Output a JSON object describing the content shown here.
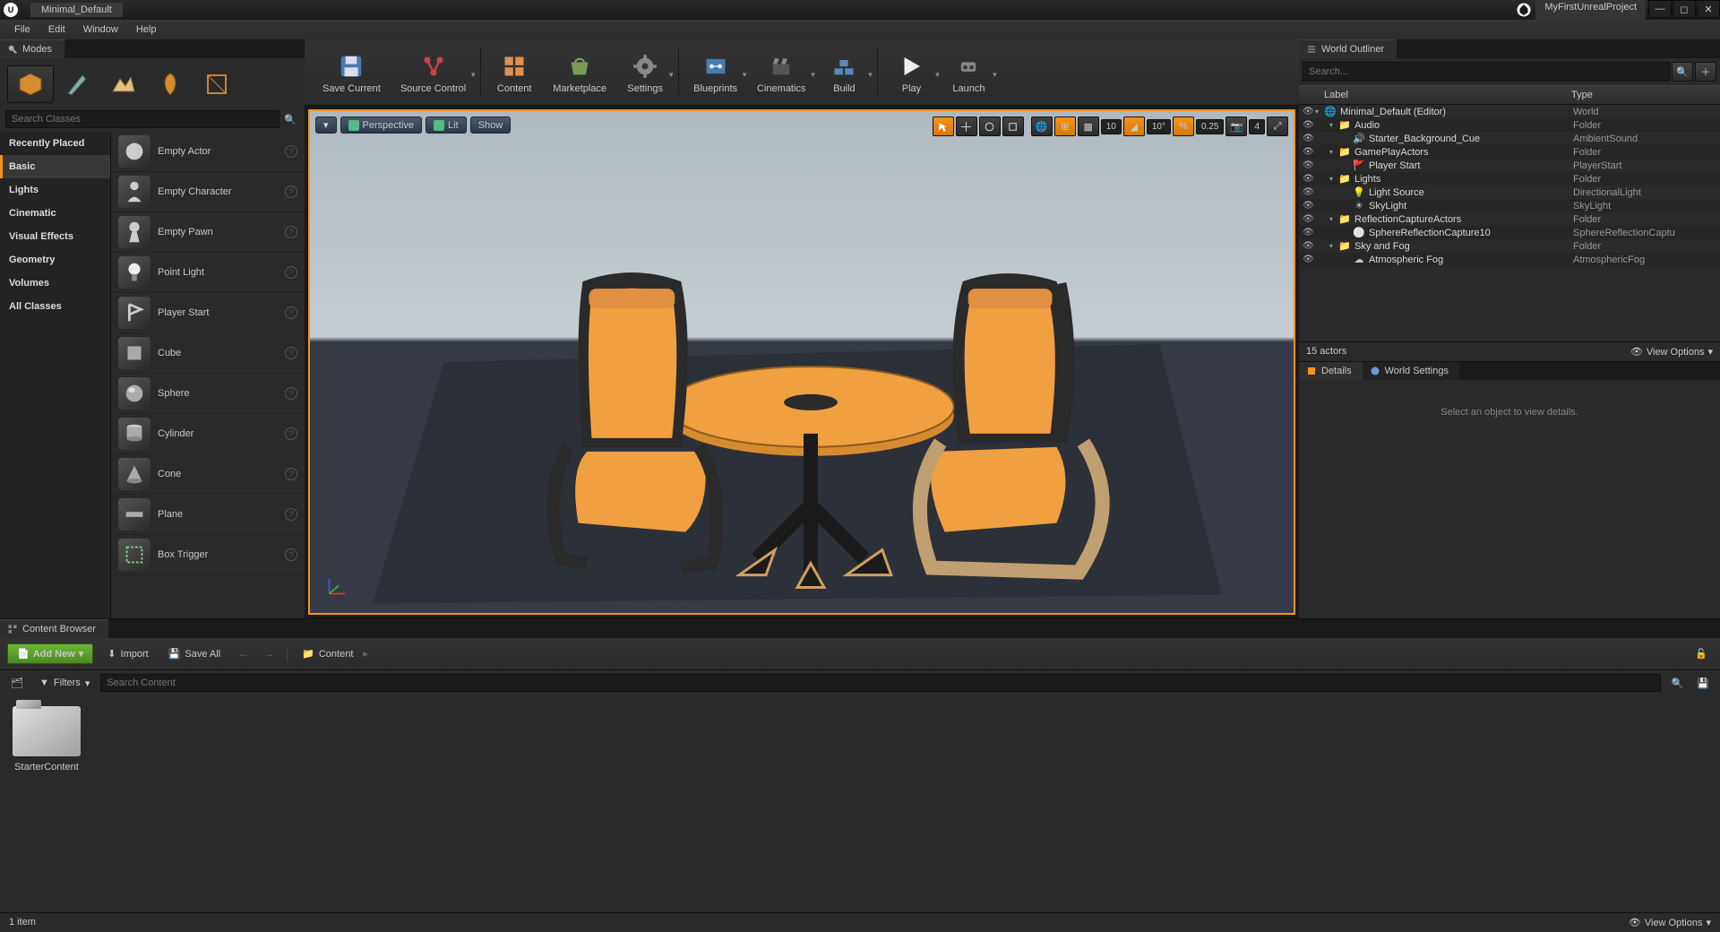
{
  "titlebar": {
    "doc_name": "Minimal_Default",
    "project_name": "MyFirstUnrealProject"
  },
  "menubar": [
    "File",
    "Edit",
    "Window",
    "Help"
  ],
  "modes_panel_title": "Modes",
  "search_classes_placeholder": "Search Classes",
  "place_categories": [
    {
      "label": "Recently Placed",
      "active": false
    },
    {
      "label": "Basic",
      "active": true
    },
    {
      "label": "Lights",
      "active": false
    },
    {
      "label": "Cinematic",
      "active": false
    },
    {
      "label": "Visual Effects",
      "active": false
    },
    {
      "label": "Geometry",
      "active": false
    },
    {
      "label": "Volumes",
      "active": false
    },
    {
      "label": "All Classes",
      "active": false
    }
  ],
  "place_items": [
    {
      "label": "Empty Actor",
      "icon": "actor"
    },
    {
      "label": "Empty Character",
      "icon": "character"
    },
    {
      "label": "Empty Pawn",
      "icon": "pawn"
    },
    {
      "label": "Point Light",
      "icon": "light"
    },
    {
      "label": "Player Start",
      "icon": "playerstart"
    },
    {
      "label": "Cube",
      "icon": "cube"
    },
    {
      "label": "Sphere",
      "icon": "sphere"
    },
    {
      "label": "Cylinder",
      "icon": "cylinder"
    },
    {
      "label": "Cone",
      "icon": "cone"
    },
    {
      "label": "Plane",
      "icon": "plane"
    },
    {
      "label": "Box Trigger",
      "icon": "boxtrigger"
    }
  ],
  "toolbar": {
    "save": "Save Current",
    "source": "Source Control",
    "content": "Content",
    "marketplace": "Marketplace",
    "settings": "Settings",
    "blueprints": "Blueprints",
    "cinematics": "Cinematics",
    "build": "Build",
    "play": "Play",
    "launch": "Launch"
  },
  "viewport": {
    "perspective": "Perspective",
    "lit": "Lit",
    "show": "Show",
    "grid_size": "10",
    "angle_snap": "10°",
    "scale_snap": "0.25",
    "cam_speed": "4"
  },
  "outliner": {
    "title": "World Outliner",
    "search_placeholder": "Search...",
    "col_label": "Label",
    "col_type": "Type",
    "count": "15 actors",
    "view_options": "View Options",
    "tree": [
      {
        "depth": 0,
        "arrow": "▾",
        "icon": "world",
        "label": "Minimal_Default (Editor)",
        "type": "World"
      },
      {
        "depth": 1,
        "arrow": "▾",
        "icon": "folder",
        "label": "Audio",
        "type": "Folder"
      },
      {
        "depth": 2,
        "arrow": "",
        "icon": "sound",
        "label": "Starter_Background_Cue",
        "type": "AmbientSound"
      },
      {
        "depth": 1,
        "arrow": "▾",
        "icon": "folder",
        "label": "GamePlayActors",
        "type": "Folder"
      },
      {
        "depth": 2,
        "arrow": "",
        "icon": "playerstart",
        "label": "Player Start",
        "type": "PlayerStart"
      },
      {
        "depth": 1,
        "arrow": "▾",
        "icon": "folder",
        "label": "Lights",
        "type": "Folder"
      },
      {
        "depth": 2,
        "arrow": "",
        "icon": "light",
        "label": "Light Source",
        "type": "DirectionalLight"
      },
      {
        "depth": 2,
        "arrow": "",
        "icon": "skylight",
        "label": "SkyLight",
        "type": "SkyLight"
      },
      {
        "depth": 1,
        "arrow": "▾",
        "icon": "folder",
        "label": "ReflectionCaptureActors",
        "type": "Folder"
      },
      {
        "depth": 2,
        "arrow": "",
        "icon": "sphere",
        "label": "SphereReflectionCapture10",
        "type": "SphereReflectionCaptu"
      },
      {
        "depth": 1,
        "arrow": "▾",
        "icon": "folder",
        "label": "Sky and Fog",
        "type": "Folder"
      },
      {
        "depth": 2,
        "arrow": "",
        "icon": "fog",
        "label": "Atmospheric Fog",
        "type": "AtmosphericFog"
      }
    ]
  },
  "details": {
    "tab_details": "Details",
    "tab_world": "World Settings",
    "empty_msg": "Select an object to view details."
  },
  "content_browser": {
    "title": "Content Browser",
    "add_new": "Add New",
    "import": "Import",
    "save_all": "Save All",
    "path": "Content",
    "filters": "Filters",
    "search_placeholder": "Search Content",
    "assets": [
      {
        "name": "StarterContent",
        "type": "folder"
      }
    ],
    "item_count": "1 item",
    "view_options": "View Options"
  }
}
